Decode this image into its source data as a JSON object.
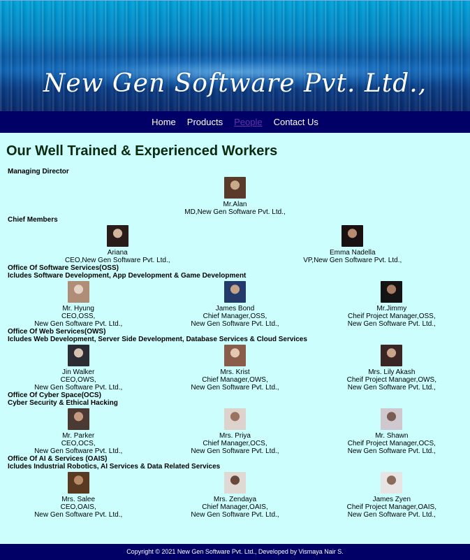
{
  "header": {
    "logo_text": "New Gen Software Pvt. Ltd.,"
  },
  "nav": {
    "items": [
      {
        "label": "Home",
        "active": false
      },
      {
        "label": "Products",
        "active": false
      },
      {
        "label": "People",
        "active": true
      },
      {
        "label": "Contact Us",
        "active": false
      }
    ]
  },
  "page_title": "Our Well Trained & Experienced Workers",
  "sections": [
    {
      "title": "Managing Director",
      "subtitle": "",
      "layout": "single",
      "members": [
        {
          "name": "Mr.Alan",
          "role": "MD,New Gen Software Pvt. Ltd.,",
          "org": ""
        }
      ]
    },
    {
      "title": "Chief Members",
      "subtitle": "",
      "layout": "pair",
      "members": [
        {
          "name": "Ariana",
          "role": "CEO,New Gen Software Pvt. Ltd.,",
          "org": ""
        },
        {
          "name": "Emma Nadella",
          "role": "VP,New Gen Software Pvt. Ltd.,",
          "org": ""
        }
      ]
    },
    {
      "title": "Office Of Software Services(OSS)",
      "subtitle": "Icludes Software Development, App Development & Game Development",
      "layout": "triple",
      "members": [
        {
          "name": "Mr. Hyung",
          "role": "CEO,OSS,",
          "org": "New Gen Software Pvt. Ltd.,"
        },
        {
          "name": "James Bond",
          "role": "Chief Manager,OSS,",
          "org": "New Gen Software Pvt. Ltd.,"
        },
        {
          "name": "Mr.Jimmy",
          "role": "Cheif Project Manager,OSS,",
          "org": "New Gen Software Pvt. Ltd.,"
        }
      ]
    },
    {
      "title": "Office Of Web Services(OWS)",
      "subtitle": "Icludes Web Development, Server Side Development, Database Services & Cloud Services",
      "layout": "triple",
      "members": [
        {
          "name": "Jin Walker",
          "role": "CEO,OWS,",
          "org": "New Gen Software Pvt. Ltd.,"
        },
        {
          "name": "Mrs. Krist",
          "role": "Chief Manager,OWS,",
          "org": "New Gen Software Pvt. Ltd.,"
        },
        {
          "name": "Mrs. Lily Akash",
          "role": "Cheif Project Manager,OWS,",
          "org": "New Gen Software Pvt. Ltd.,"
        }
      ]
    },
    {
      "title": "Office Of Cyber Space(OCS)",
      "subtitle": "Cyber Security & Ethical Hacking",
      "layout": "triple",
      "members": [
        {
          "name": "Mr. Parker",
          "role": "CEO,OCS,",
          "org": "New Gen Software Pvt. Ltd.,"
        },
        {
          "name": "Mrs. Priya",
          "role": "Chief Manager,OCS,",
          "org": "New Gen Software Pvt. Ltd.,"
        },
        {
          "name": "Mr. Shawn",
          "role": "Cheif Project Manager,OCS,",
          "org": "New Gen Software Pvt. Ltd.,"
        }
      ]
    },
    {
      "title": "Office Of AI & Services (OAIS)",
      "subtitle": "Icludes Industrial Robotics, AI Services & Data Related Services",
      "layout": "triple",
      "members": [
        {
          "name": "Mrs. Salee",
          "role": "CEO,OAIS,",
          "org": "New Gen Software Pvt. Ltd.,"
        },
        {
          "name": "Mrs. Zendaya",
          "role": "Chief Manager,OAIS,",
          "org": "New Gen Software Pvt. Ltd.,"
        },
        {
          "name": "James Zyen",
          "role": "Cheif Project Manager,OAIS,",
          "org": "New Gen Software Pvt. Ltd.,"
        }
      ]
    }
  ],
  "footer": {
    "text": "Copyright © 2021 New Gen Software Pvt. Ltd., Developed by Vismaya Nair S."
  },
  "colors": {
    "nav_bg": "#000066",
    "page_bg": "#ccfefe",
    "active_link": "#6633aa"
  }
}
